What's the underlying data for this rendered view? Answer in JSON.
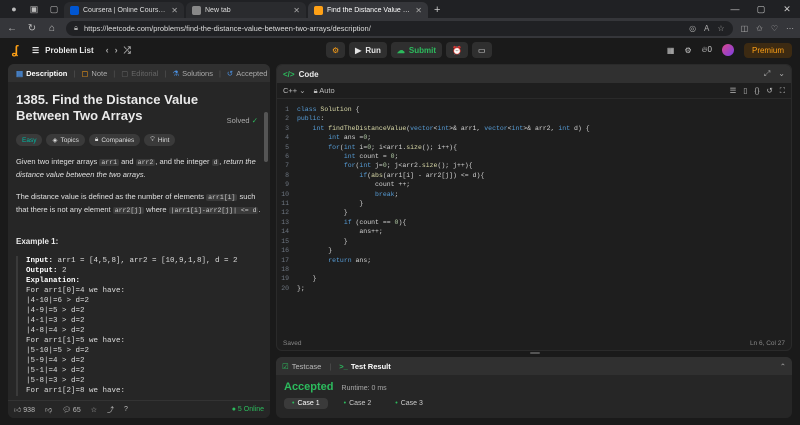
{
  "browser": {
    "tabs": [
      {
        "title": "Coursera | Online Courses From T",
        "color": "#0056d2"
      },
      {
        "title": "New tab",
        "color": "#888888"
      },
      {
        "title": "Find the Distance Value Between",
        "color": "#ffa116"
      }
    ],
    "url": "https://leetcode.com/problems/find-the-distance-value-between-two-arrays/description/"
  },
  "topbar": {
    "problem_list": "Problem List",
    "run": "Run",
    "submit": "Submit",
    "streak": "0",
    "premium": "Premium"
  },
  "left": {
    "tabs": [
      "Description",
      "Note",
      "Editorial",
      "Solutions",
      "Accepted"
    ],
    "title": "1385. Find the Distance Value Between Two Arrays",
    "solved": "Solved",
    "badges": [
      "Easy",
      "Topics",
      "Companies",
      "Hint"
    ],
    "p1_a": "Given two integer arrays ",
    "p1_c1": "arr1",
    "p1_b": " and ",
    "p1_c2": "arr2",
    "p1_c": ", and the integer ",
    "p1_c3": "d",
    "p1_d": ", return the distance value between the two arrays.",
    "p2_a": "The distance value is defined as the number of elements ",
    "p2_c1": "arr1[i]",
    "p2_b": " such that there is not any element ",
    "p2_c2": "arr2[j]",
    "p2_c": " where ",
    "p2_c3": "|arr1[i]-arr2[j]| <= d",
    "p2_d": ".",
    "example_title": "Example 1:",
    "ex_input_label": "Input:",
    "ex_input": " arr1 = [4,5,8], arr2 = [10,9,1,8], d = 2",
    "ex_output_label": "Output:",
    "ex_output": " 2",
    "ex_expl_label": "Explanation:",
    "ex_lines": [
      "For arr1[0]=4 we have:",
      "|4-10|=6 > d=2",
      "|4-9|=5 > d=2",
      "|4-1|=3 > d=2",
      "|4-8|=4 > d=2",
      "For arr1[1]=5 we have:",
      "|5-10|=5 > d=2",
      "|5-9|=4 > d=2",
      "|5-1|=4 > d=2",
      "|5-8|=3 > d=2",
      "For arr1[2]=8 we have:"
    ],
    "likes": "938",
    "comments": "65",
    "online": "5 Online"
  },
  "code": {
    "title": "Code",
    "lang": "C++",
    "mode": "Auto",
    "lines": [
      "class Solution {",
      "public:",
      "    int findTheDistanceValue(vector<int>& arr1, vector<int>& arr2, int d) {",
      "        int ans =0;",
      "        for(int i=0; i<arr1.size(); i++){",
      "            int count = 0;",
      "            for(int j=0; j<arr2.size(); j++){",
      "                if(abs(arr1[i] - arr2[j]) <= d){",
      "                    count ++;",
      "                    break;",
      "                }",
      "            }",
      "            if (count == 0){",
      "                ans++;",
      "            }",
      "        }",
      "        return ans;",
      "",
      "    }",
      "};"
    ],
    "saved": "Saved",
    "cursor": "Ln 6, Col 27"
  },
  "test": {
    "tab1": "Testcase",
    "tab2": "Test Result",
    "result": "Accepted",
    "runtime": "Runtime: 0 ms",
    "cases": [
      "Case 1",
      "Case 2",
      "Case 3"
    ]
  }
}
